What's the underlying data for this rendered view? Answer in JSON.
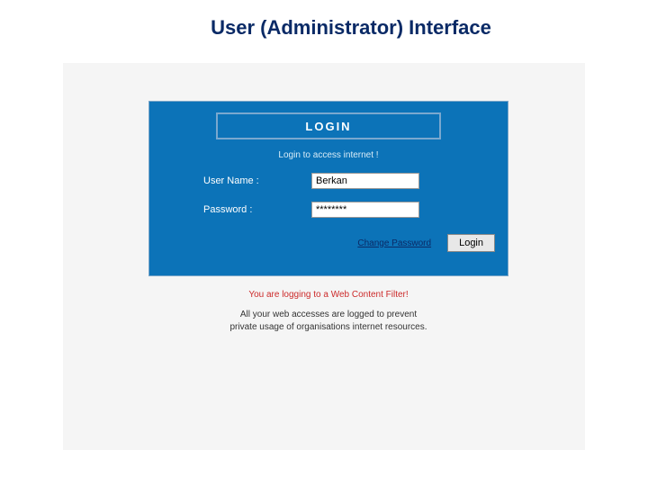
{
  "page": {
    "title": "User (Administrator) Interface"
  },
  "login": {
    "header": "LOGIN",
    "subtitle": "Login to access internet !",
    "username_label": "User Name :",
    "username_value": "Berkan",
    "password_label": "Password :",
    "password_value": "********",
    "change_password": "Change Password",
    "login_button": "Login"
  },
  "warning": {
    "line1": "You are logging to a Web Content Filter!",
    "line2a": "All your web accesses are logged to prevent",
    "line2b": "private usage of organisations internet resources."
  }
}
